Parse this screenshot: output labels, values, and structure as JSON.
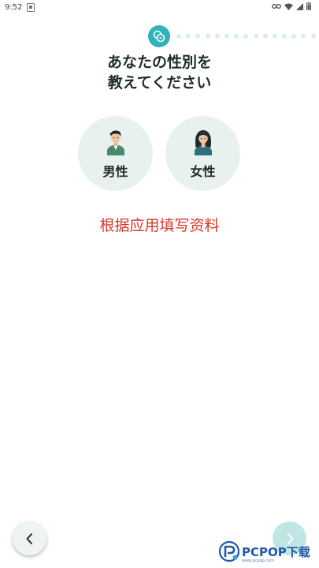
{
  "status_bar": {
    "time": "9:52"
  },
  "progress": {
    "total_steps": 16,
    "current_step": 1
  },
  "question": {
    "line1": "あなたの性別を",
    "line2": "教えてください"
  },
  "options": [
    {
      "label": "男性",
      "icon": "male-avatar-icon"
    },
    {
      "label": "女性",
      "icon": "female-avatar-icon"
    }
  ],
  "note": "根据应用填写资料",
  "watermark": {
    "brand": "PCPOP下载",
    "sub": "www.pcpop.com"
  },
  "colors": {
    "accent": "#2fb2b8",
    "option_bg": "#e9f1ef",
    "note": "#d8382b",
    "title": "#1e2c2d"
  }
}
